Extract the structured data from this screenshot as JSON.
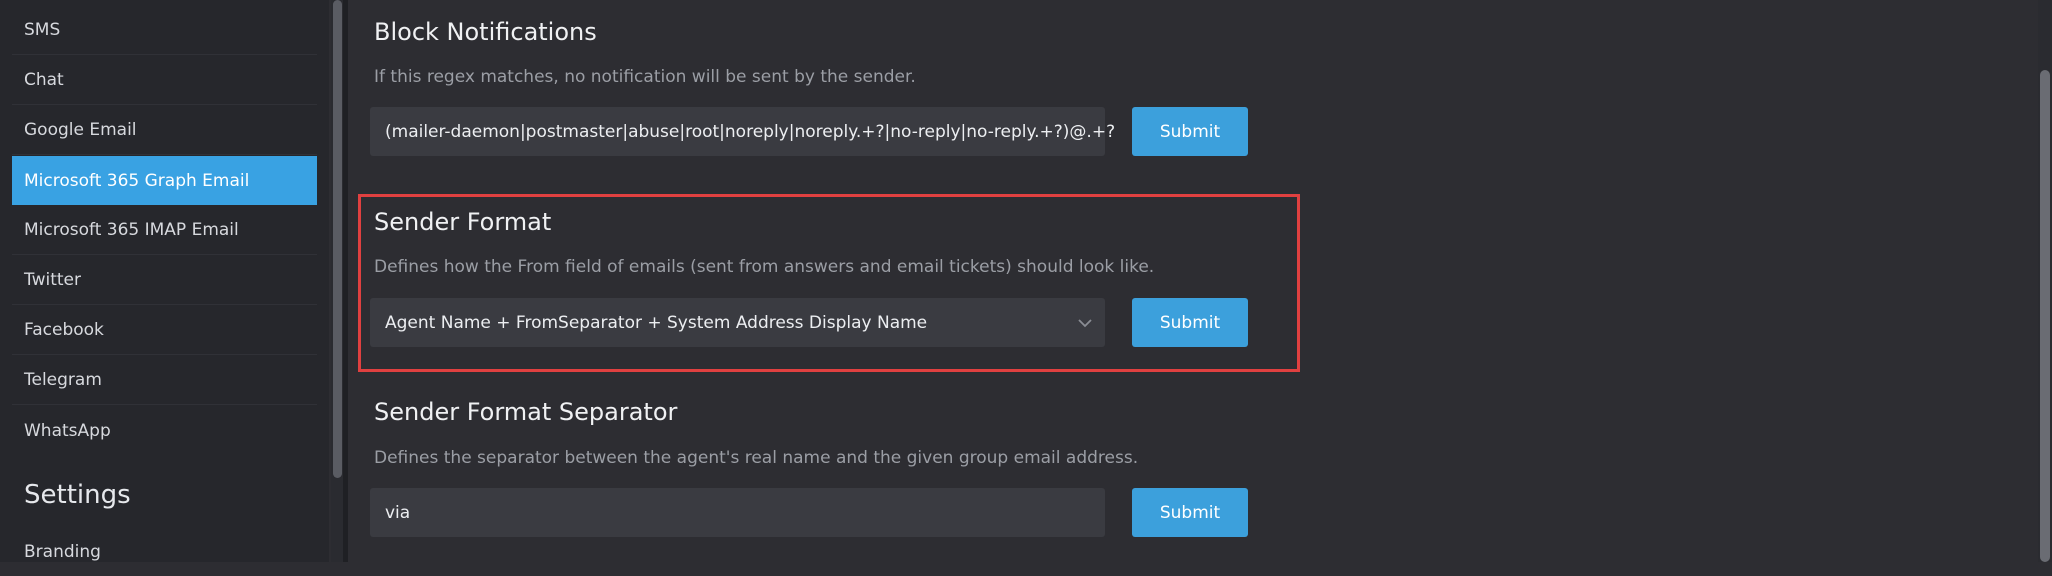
{
  "sidebar": {
    "items": [
      {
        "label": "SMS",
        "active": false
      },
      {
        "label": "Chat",
        "active": false
      },
      {
        "label": "Google Email",
        "active": false
      },
      {
        "label": "Microsoft 365 Graph Email",
        "active": true
      },
      {
        "label": "Microsoft 365 IMAP Email",
        "active": false
      },
      {
        "label": "Twitter",
        "active": false
      },
      {
        "label": "Facebook",
        "active": false
      },
      {
        "label": "Telegram",
        "active": false
      },
      {
        "label": "WhatsApp",
        "active": false
      }
    ],
    "section_title": "Settings",
    "section_items": [
      {
        "label": "Branding"
      }
    ]
  },
  "settings": [
    {
      "title": "Block Notifications",
      "description": "If this regex matches, no notification will be sent by the sender.",
      "value": "(mailer-daemon|postmaster|abuse|root|noreply|noreply.+?|no-reply|no-reply.+?)@.+?",
      "submit_label": "Submit"
    },
    {
      "title": "Sender Format",
      "description": "Defines how the From field of emails (sent from answers and email tickets) should look like.",
      "value": "Agent Name + FromSeparator + System Address Display Name",
      "submit_label": "Submit"
    },
    {
      "title": "Sender Format Separator",
      "description": "Defines the separator between the agent's real name and the given group email address.",
      "value": "via",
      "submit_label": "Submit"
    }
  ],
  "colors": {
    "accent": "#39a2e3",
    "highlight": "#e04040",
    "background": "#2d2d32",
    "sidebar": "#26272c"
  }
}
